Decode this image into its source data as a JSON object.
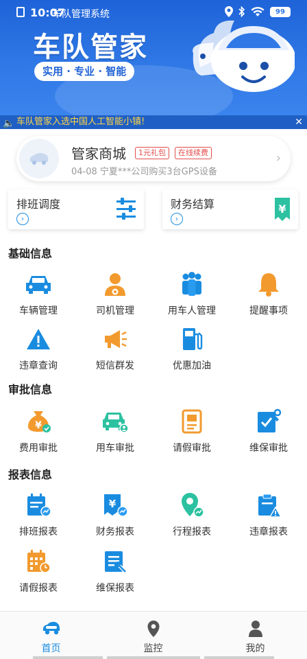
{
  "status": {
    "time": "10:07",
    "app_title": "车队管理系统",
    "battery": "99"
  },
  "banner": {
    "brand": "车队管家",
    "tagline": "实用 · 专业 · 智能"
  },
  "notice": {
    "text": "车队管家入选中国人工智能小镇!"
  },
  "mall": {
    "title": "管家商城",
    "tag1": "1元礼包",
    "tag2": "在线续费",
    "sub": "04-08  宁夏***公司购买3台GPS设备"
  },
  "quick": [
    {
      "label": "排班调度"
    },
    {
      "label": "财务结算"
    }
  ],
  "sections": {
    "basic": {
      "title": "基础信息",
      "items": [
        "车辆管理",
        "司机管理",
        "用车人管理",
        "提醒事项",
        "违章查询",
        "短信群发",
        "优惠加油"
      ]
    },
    "approval": {
      "title": "审批信息",
      "items": [
        "费用审批",
        "用车审批",
        "请假审批",
        "维保审批"
      ]
    },
    "report": {
      "title": "报表信息",
      "items": [
        "排班报表",
        "财务报表",
        "行程报表",
        "违章报表",
        "请假报表",
        "维保报表"
      ]
    }
  },
  "nav": [
    {
      "label": "首页"
    },
    {
      "label": "监控"
    },
    {
      "label": "我的"
    }
  ],
  "colors": {
    "primary": "#1a8ce0",
    "orange": "#f29a2e",
    "teal": "#2cc1a0",
    "banner": "#2f78e6"
  }
}
